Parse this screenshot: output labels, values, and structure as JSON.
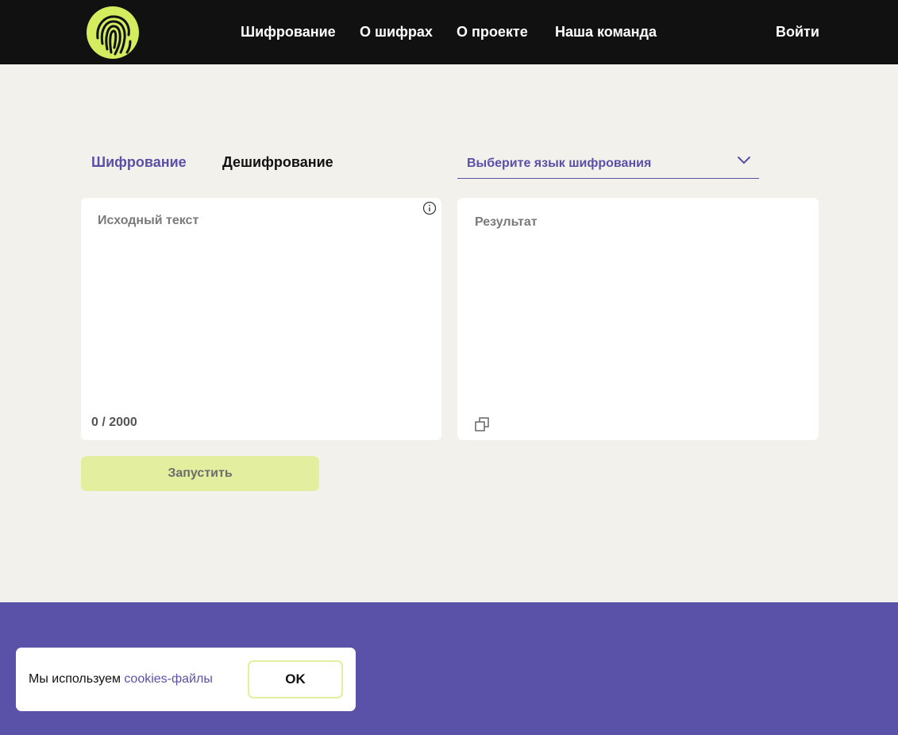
{
  "header": {
    "nav": [
      "Шифрование",
      "О шифрах",
      "О проекте",
      "Наша команда"
    ],
    "login_label": "Войти",
    "logo_icon": "fingerprint-icon",
    "logo_color": "#d4ed5f"
  },
  "tabs": {
    "encrypt": "Шифрование",
    "decrypt": "Дешифрование",
    "active": "encrypt"
  },
  "language_select": {
    "placeholder": "Выберите язык шифрования",
    "icon": "chevron-down-icon"
  },
  "source_panel": {
    "placeholder": "Исходный текст",
    "value": "",
    "counter": "0 / 2000",
    "icon": "info-icon"
  },
  "result_panel": {
    "label": "Результат",
    "icon": "copy-icon"
  },
  "run_button": {
    "label": "Запустить"
  },
  "cookie_banner": {
    "text": "Мы используем ",
    "link": "cookies-файлы",
    "ok_label": "OK"
  },
  "colors": {
    "header_bg": "#111111",
    "page_bg": "#f2f1ec",
    "accent": "#5a50a8",
    "lime": "#e3ef9e",
    "footer_bg": "#5a52a9"
  }
}
